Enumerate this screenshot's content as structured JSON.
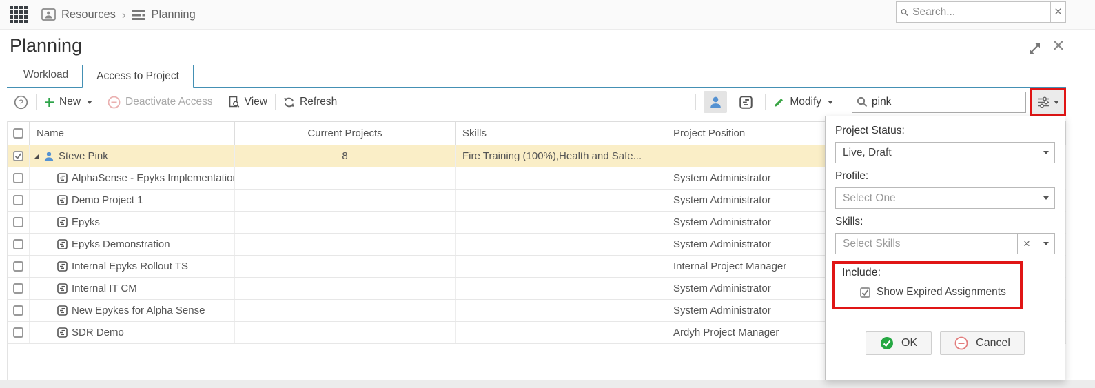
{
  "topbar": {
    "breadcrumb": {
      "resources": "Resources",
      "planning": "Planning"
    },
    "search_placeholder": "Search..."
  },
  "page": {
    "title": "Planning"
  },
  "tabs": {
    "workload": "Workload",
    "access": "Access to Project"
  },
  "toolbar": {
    "new": "New",
    "deactivate": "Deactivate Access",
    "view": "View",
    "refresh": "Refresh",
    "modify": "Modify",
    "search_value": "pink"
  },
  "table": {
    "headers": {
      "name": "Name",
      "current_projects": "Current Projects",
      "skills": "Skills",
      "project_position": "Project Position"
    },
    "parent": {
      "name": "Steve Pink",
      "current_projects": "8",
      "skills": "Fire Training (100%),Health and Safe...",
      "project_position": "",
      "checked": true
    },
    "rows": [
      {
        "name": "AlphaSense - Epyks Implementation",
        "position": "System Administrator"
      },
      {
        "name": "Demo Project 1",
        "position": "System Administrator"
      },
      {
        "name": "Epyks",
        "position": "System Administrator"
      },
      {
        "name": "Epyks Demonstration",
        "position": "System Administrator"
      },
      {
        "name": "Internal Epyks Rollout TS",
        "position": "Internal Project Manager"
      },
      {
        "name": "Internal IT CM",
        "position": "System Administrator"
      },
      {
        "name": "New Epykes for Alpha Sense",
        "position": "System Administrator"
      },
      {
        "name": "SDR Demo",
        "position": "Ardyh Project Manager"
      }
    ]
  },
  "filter_panel": {
    "project_status_label": "Project Status:",
    "project_status_value": "Live, Draft",
    "profile_label": "Profile:",
    "profile_placeholder": "Select One",
    "skills_label": "Skills:",
    "skills_placeholder": "Select Skills",
    "include_label": "Include:",
    "show_expired_label": "Show Expired Assignments",
    "show_expired_checked": true,
    "ok": "OK",
    "cancel": "Cancel"
  },
  "colors": {
    "accent_blue": "#4490b4",
    "selected_row_yellow": "#faeec7",
    "annotation_red": "#e01515",
    "action_green": "#2ea44a",
    "person_blue": "#5592d2"
  }
}
